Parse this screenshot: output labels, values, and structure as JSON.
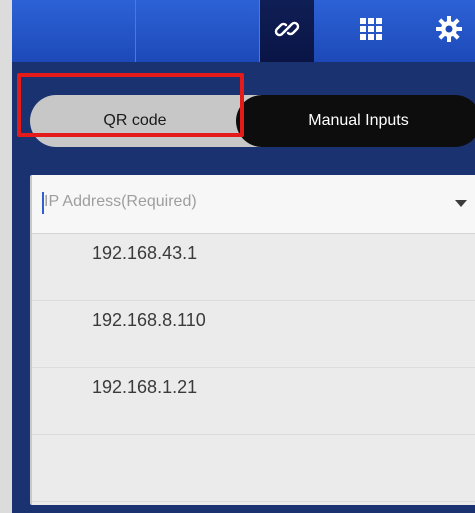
{
  "toolbar": {
    "icons": [
      "link-icon",
      "grid-icon",
      "gear-icon"
    ]
  },
  "mode_toggle": {
    "qr_label": "QR code",
    "manual_label": "Manual Inputs",
    "selected": "Manual Inputs"
  },
  "ip_dropdown": {
    "placeholder": "IP Address(Required)",
    "options": [
      "192.168.43.1",
      "192.168.8.110",
      "192.168.1.21"
    ]
  },
  "colors": {
    "toolbar_blue": "#1d49b8",
    "background_navy": "#1a3270",
    "highlight_red": "#e51a1a"
  }
}
